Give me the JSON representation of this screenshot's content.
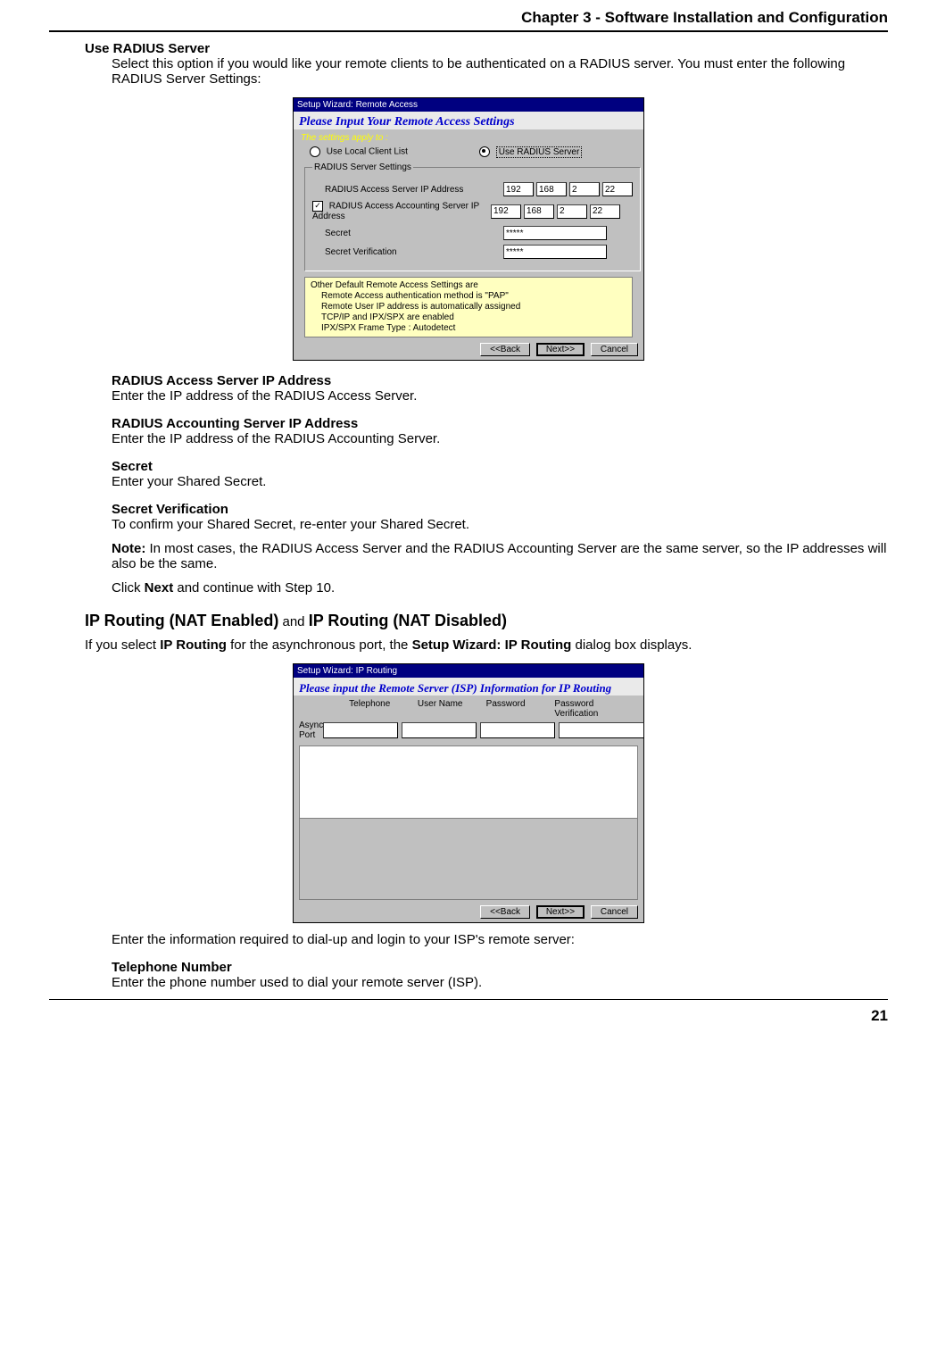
{
  "header": {
    "chapter_title": "Chapter 3 - Software Installation and Configuration"
  },
  "s1": {
    "term": "Use RADIUS Server",
    "desc": "Select this option if you would like your remote clients to be authenticated on a RADIUS server. You must enter the following RADIUS Server Settings:"
  },
  "dlg1": {
    "title": "Setup Wizard: Remote Access",
    "instr": "Please Input Your Remote Access Settings",
    "applyto": "The settings apply to :",
    "radio1": "Use Local Client List",
    "radio2": "Use RADIUS Server",
    "group_legend": "RADIUS Server Settings",
    "row1_label": "RADIUS Access Server IP Address",
    "row2_label": "RADIUS Access Accounting Server IP Address",
    "row3_label": "Secret",
    "row4_label": "Secret Verification",
    "ip1": {
      "a": "192",
      "b": "168",
      "c": "2",
      "d": "22"
    },
    "ip2": {
      "a": "192",
      "b": "168",
      "c": "2",
      "d": "22"
    },
    "secret": "*****",
    "secret_verify": "*****",
    "info_l1": "Other Default Remote Access Settings are",
    "info_l2": "Remote Access authentication method is \"PAP\"",
    "info_l3": "Remote User IP address is automatically assigned",
    "info_l4": "TCP/IP and IPX/SPX are enabled",
    "info_l5": "IPX/SPX Frame Type : Autodetect",
    "btn_back": "<<Back",
    "btn_next": "Next>>",
    "btn_cancel": "Cancel"
  },
  "s2": {
    "term": "RADIUS Access Server IP Address",
    "desc": "Enter the IP address of the RADIUS Access Server."
  },
  "s3": {
    "term": "RADIUS Accounting Server IP Address",
    "desc": "Enter the IP address of the RADIUS Accounting Server."
  },
  "s4": {
    "term": "Secret",
    "desc": "Enter your Shared Secret."
  },
  "s5": {
    "term": "Secret Verification",
    "desc": "To confirm your Shared Secret, re-enter your Shared Secret."
  },
  "note": {
    "label": "Note:",
    "text": " In most cases, the RADIUS Access Server and the RADIUS Accounting Server are the same server, so the IP addresses will also be the same."
  },
  "click_next": {
    "pre": "Click ",
    "bold": "Next",
    "post": " and continue with Step 10."
  },
  "section2": {
    "h_a": "IP Routing (NAT Enabled)",
    "and": " and ",
    "h_b": "IP Routing (NAT Disabled)",
    "intro_pre": "If you select ",
    "intro_b1": "IP Routing",
    "intro_mid": " for the asynchronous port, the ",
    "intro_b2": "Setup Wizard: IP Routing",
    "intro_post": " dialog box displays."
  },
  "dlg2": {
    "title": "Setup Wizard: IP Routing",
    "instr": "Please input the Remote Server (ISP) Information for IP Routing",
    "row_label": "Async Port",
    "col1": "Telephone",
    "col2": "User Name",
    "col3": "Password",
    "col4": "Password Verification",
    "btn_back": "<<Back",
    "btn_next": "Next>>",
    "btn_cancel": "Cancel"
  },
  "post2": "Enter the information required to dial-up and login to your ISP's remote server:",
  "s6": {
    "term": "Telephone Number",
    "desc": "Enter the phone number used to dial your remote server (ISP)."
  },
  "page_number": "21"
}
